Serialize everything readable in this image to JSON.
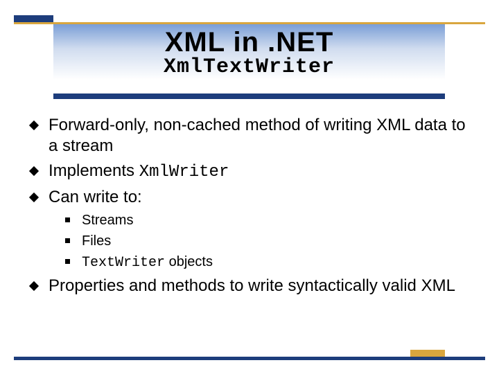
{
  "title": {
    "main": "XML in .NET",
    "sub": "XmlTextWriter"
  },
  "bullets": [
    {
      "text": "Forward-only, non-cached method of writing XML data to a stream"
    },
    {
      "prefix": "Implements ",
      "mono": "XmlWriter"
    },
    {
      "text": "Can write to:"
    }
  ],
  "sub_bullets": [
    {
      "text": "Streams"
    },
    {
      "text": "Files"
    },
    {
      "mono": "TextWriter",
      "suffix": " objects"
    }
  ],
  "bullets_after": [
    {
      "text": "Properties and methods to write syntactically valid XML"
    }
  ]
}
